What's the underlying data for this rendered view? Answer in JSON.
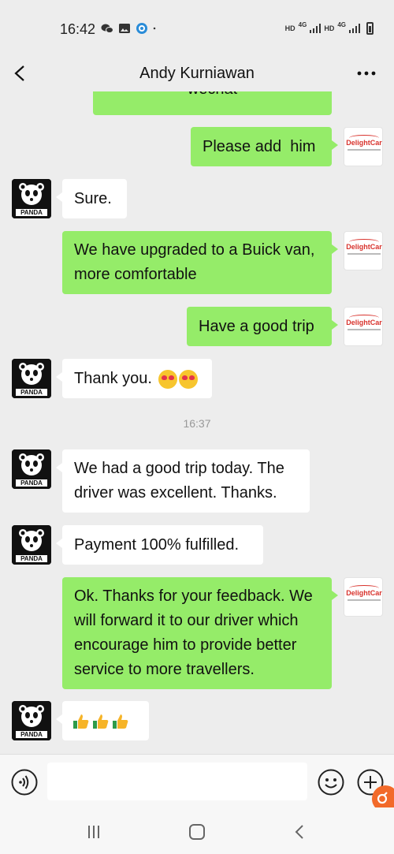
{
  "status_bar": {
    "time": "16:42",
    "network_left": "HD",
    "network_right": "HD",
    "signal_type_1": "4G",
    "signal_type_2": "4G"
  },
  "header": {
    "title": "Andy Kurniawan",
    "back_icon": "chevron-left-icon",
    "more_icon": "more-horizontal-icon"
  },
  "messages": [
    {
      "side": "sent",
      "text": "wechat"
    },
    {
      "side": "sent",
      "text": "Please add  him"
    },
    {
      "side": "recv",
      "text": "Sure."
    },
    {
      "side": "sent",
      "text": "We have upgraded to a Buick van, more comfortable"
    },
    {
      "side": "sent",
      "text": "Have a good trip"
    },
    {
      "side": "recv",
      "text": "Thank you."
    },
    {
      "side": "time",
      "text": "16:37"
    },
    {
      "side": "recv",
      "text": "We had a good trip today. The driver was excellent. Thanks."
    },
    {
      "side": "recv",
      "text": "Payment 100% fulfilled."
    },
    {
      "side": "sent",
      "text": "Ok. Thanks for your feedback. We will forward it to our driver which encourage him to provide better service to more travellers."
    },
    {
      "side": "recv",
      "text": ""
    }
  ],
  "avatars": {
    "self_logo": "DelightCar",
    "contact_logo": "PANDA"
  },
  "input_bar": {
    "value": "",
    "voice_icon": "voice-icon",
    "emoji_icon": "emoji-icon",
    "plus_icon": "plus-icon"
  },
  "nav_bar": {
    "recents_icon": "recents-icon",
    "home_icon": "home-icon",
    "back_icon": "back-icon"
  },
  "colors": {
    "sent_bubble": "#95ec69",
    "recv_bubble": "#ffffff",
    "background": "#ededed",
    "brand": "#d8322c"
  }
}
